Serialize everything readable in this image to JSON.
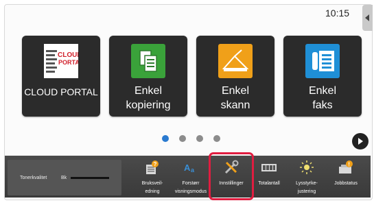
{
  "status": {
    "time": "10:15"
  },
  "tiles": [
    {
      "name": "cloud-portal",
      "icon": "cloud-portal-logo",
      "label": "CLOUD PORTAL",
      "lines": [
        "CLOUD PORTAL"
      ],
      "logo_text": [
        "CLOUD",
        "PORTAL"
      ]
    },
    {
      "name": "enkel-kopiering",
      "icon": "copy-icon",
      "label": "Enkel kopiering",
      "lines": [
        "Enkel",
        "kopiering"
      ]
    },
    {
      "name": "enkel-skann",
      "icon": "scan-icon",
      "label": "Enkel skann",
      "lines": [
        "Enkel",
        "skann"
      ]
    },
    {
      "name": "enkel-faks",
      "icon": "fax-icon",
      "label": "Enkel faks",
      "lines": [
        "Enkel",
        "faks"
      ]
    }
  ],
  "pagination": {
    "pages": 4,
    "current": 1
  },
  "bottom_bar": {
    "toner_label": "Tonerkvalitet",
    "toner_color": "Bk",
    "items": [
      {
        "name": "bruksveiledning",
        "icon": "manual-icon",
        "lines": [
          "Bruksveil-",
          "edning"
        ]
      },
      {
        "name": "forstorr-visningsmodus",
        "icon": "magnify-text-icon",
        "lines": [
          "Forstørr",
          "visningsmodus"
        ]
      },
      {
        "name": "innstillinger",
        "icon": "settings-tools-icon",
        "lines": [
          "Innstillinger"
        ]
      },
      {
        "name": "totalantall",
        "icon": "counter-icon",
        "lines": [
          "Totalantall"
        ]
      },
      {
        "name": "lysstyrkejustering",
        "icon": "brightness-icon",
        "lines": [
          "Lysstyrke-",
          "justering"
        ]
      },
      {
        "name": "jobbstatus",
        "icon": "job-status-icon",
        "lines": [
          "Jobbstatus"
        ]
      }
    ]
  },
  "colors": {
    "highlight": "#e01d40",
    "tile_bg": "#2b2b2b",
    "active_dot": "#2a7ad0",
    "bar_bg": "#444444"
  }
}
